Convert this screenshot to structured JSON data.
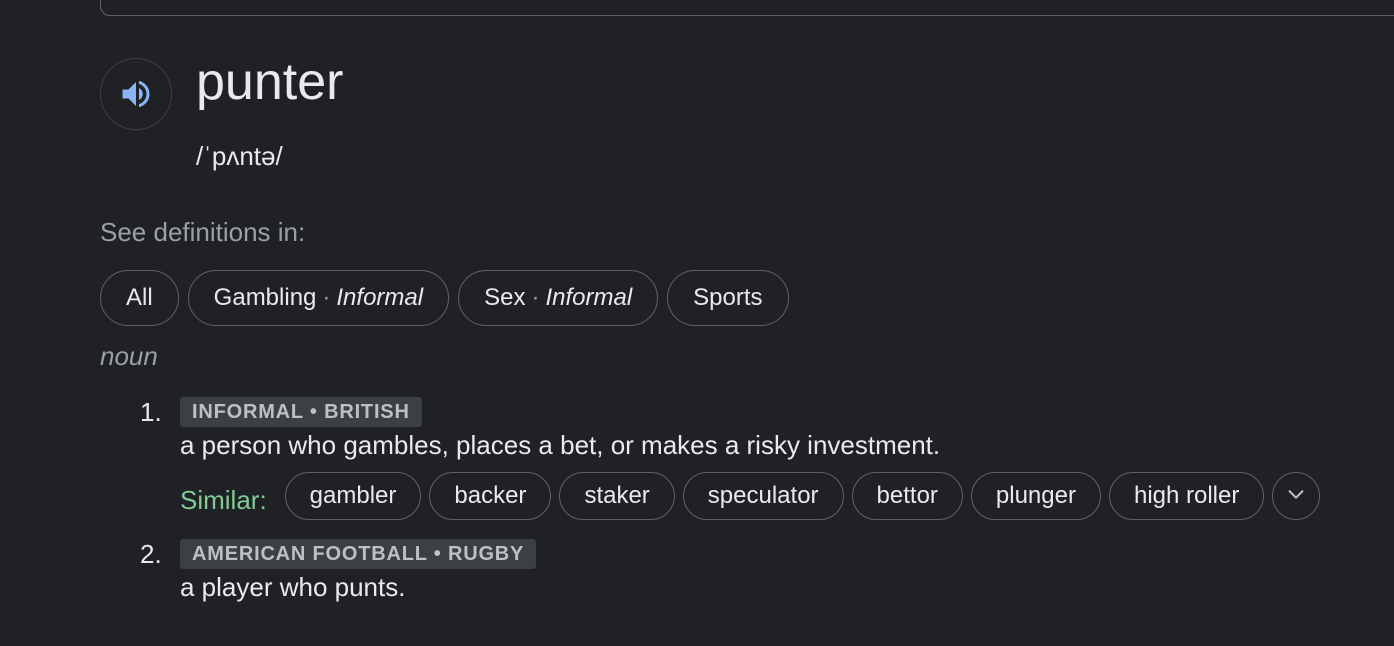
{
  "entry": {
    "word": "punter",
    "phonetic": "/ˈpʌntə/",
    "speaker_icon": "speaker-icon"
  },
  "see_definitions": {
    "label": "See definitions in:",
    "chips": [
      {
        "name": "All",
        "register": ""
      },
      {
        "name": "Gambling",
        "sep": "·",
        "register": "Informal"
      },
      {
        "name": "Sex",
        "sep": "·",
        "register": "Informal"
      },
      {
        "name": "Sports",
        "register": ""
      }
    ]
  },
  "part_of_speech": "noun",
  "definitions": [
    {
      "number": "1.",
      "labels": "INFORMAL • BRITISH",
      "text": "a person who gambles, places a bet, or makes a risky investment.",
      "similar_label": "Similar:",
      "similar": [
        "gambler",
        "backer",
        "staker",
        "speculator",
        "bettor",
        "plunger",
        "high roller"
      ],
      "more_icon": "chevron-down-icon"
    },
    {
      "number": "2.",
      "labels": "AMERICAN FOOTBALL • RUGBY",
      "text": "a player who punts."
    }
  ],
  "colors": {
    "background": "#202124",
    "text_primary": "#e8eaed",
    "text_secondary": "#9aa0a6",
    "similar_green": "#81c995",
    "speaker_blue": "#8ab4f8",
    "label_bg": "#3c4043"
  }
}
